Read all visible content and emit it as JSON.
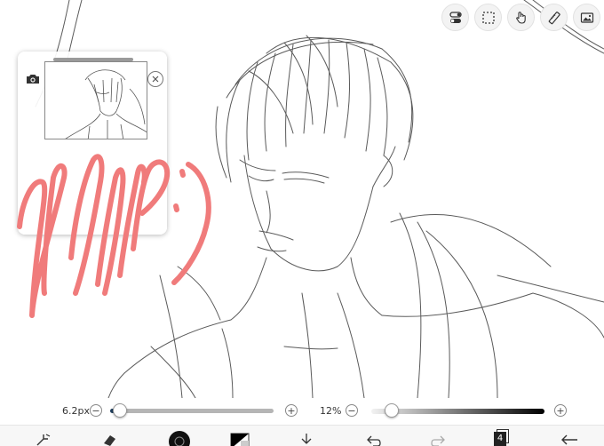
{
  "brush": {
    "size_label": "6.2px",
    "size_fraction": 0.06,
    "minus_label": "−",
    "plus_label": "+"
  },
  "opacity": {
    "label": "12%",
    "value_fraction": 0.12,
    "minus_label": "−",
    "plus_label": "+"
  },
  "toolbar": {
    "layers_count": "4"
  },
  "colors": {
    "wip_stroke": "#f07b7b",
    "slider_fill": "#1d3d5c",
    "sketch_line": "#5a5a5a"
  },
  "icons": {
    "top": [
      "toggle-icon",
      "selection-icon",
      "hand-icon",
      "ruler-icon",
      "material-icon"
    ],
    "bottom": [
      "transform-icon",
      "eraser-icon",
      "brush-icon",
      "color-icon",
      "download-icon",
      "undo-icon",
      "redo-icon",
      "layers-icon",
      "back-icon"
    ]
  }
}
